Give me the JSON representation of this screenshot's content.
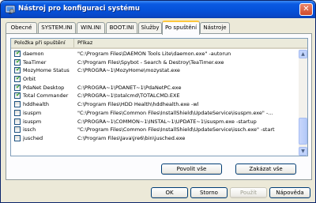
{
  "window": {
    "title": "Nástroj pro konfiguraci systému",
    "close_glyph": "✕"
  },
  "tabs": [
    {
      "label": "Obecné"
    },
    {
      "label": "SYSTEM.INI"
    },
    {
      "label": "WIN.INI"
    },
    {
      "label": "BOOT.INI"
    },
    {
      "label": "Služby"
    },
    {
      "label": "Po spuštění",
      "active": true
    },
    {
      "label": "Nástroje"
    }
  ],
  "list": {
    "headers": {
      "name": "Položka při spuštění",
      "command": "Příkaz"
    },
    "rows": [
      {
        "checked": true,
        "name": "daemon",
        "command": "\"C:\\Program Files\\DAEMON Tools Lite\\daemon.exe\" -autorun"
      },
      {
        "checked": true,
        "name": "TeaTimer",
        "command": "C:\\Program Files\\Spybot - Search & Destroy\\TeaTimer.exe"
      },
      {
        "checked": true,
        "name": "MozyHome Status",
        "command": "C:\\PROGRA~1\\MozyHome\\mozystat.exe"
      },
      {
        "checked": true,
        "name": "Orbit",
        "command": ""
      },
      {
        "checked": true,
        "name": "PdaNet Desktop",
        "command": "C:\\PROGRA~1\\PDANET~1\\PdaNetPC.exe"
      },
      {
        "checked": true,
        "name": "Total Commander",
        "command": "C:\\PROGRA~1\\totalcmd\\TOTALCMD.EXE"
      },
      {
        "checked": false,
        "name": "hddhealth",
        "command": "C:\\Program Files\\HDD Health\\hddhealth.exe -wl"
      },
      {
        "checked": false,
        "name": "isuspm",
        "command": "\"C:\\Program Files\\Common Files\\InstallShield\\UpdateService\\isuspm.exe\" -..."
      },
      {
        "checked": false,
        "name": "isuspm",
        "command": "C:\\PROGRA~1\\COMMON~1\\INSTAL~1\\UPDATE~1\\isuspm.exe -startup"
      },
      {
        "checked": false,
        "name": "issch",
        "command": "\"C:\\Program Files\\Common Files\\InstallShield\\UpdateService\\issch.exe\" -start"
      },
      {
        "checked": false,
        "name": "jusched",
        "command": "C:\\Program Files\\Java\\jre6\\bin\\jusched.exe"
      }
    ]
  },
  "panel_buttons": {
    "enable_all": "Povolit vše",
    "disable_all": "Zakázat vše"
  },
  "dialog_buttons": {
    "ok": "OK",
    "cancel": "Storno",
    "apply": "Použít",
    "help": "Nápověda"
  },
  "colors": {
    "title_bar": "#0552d9",
    "active_tab_accent": "#ffc83c",
    "check_mark": "#21a121"
  }
}
